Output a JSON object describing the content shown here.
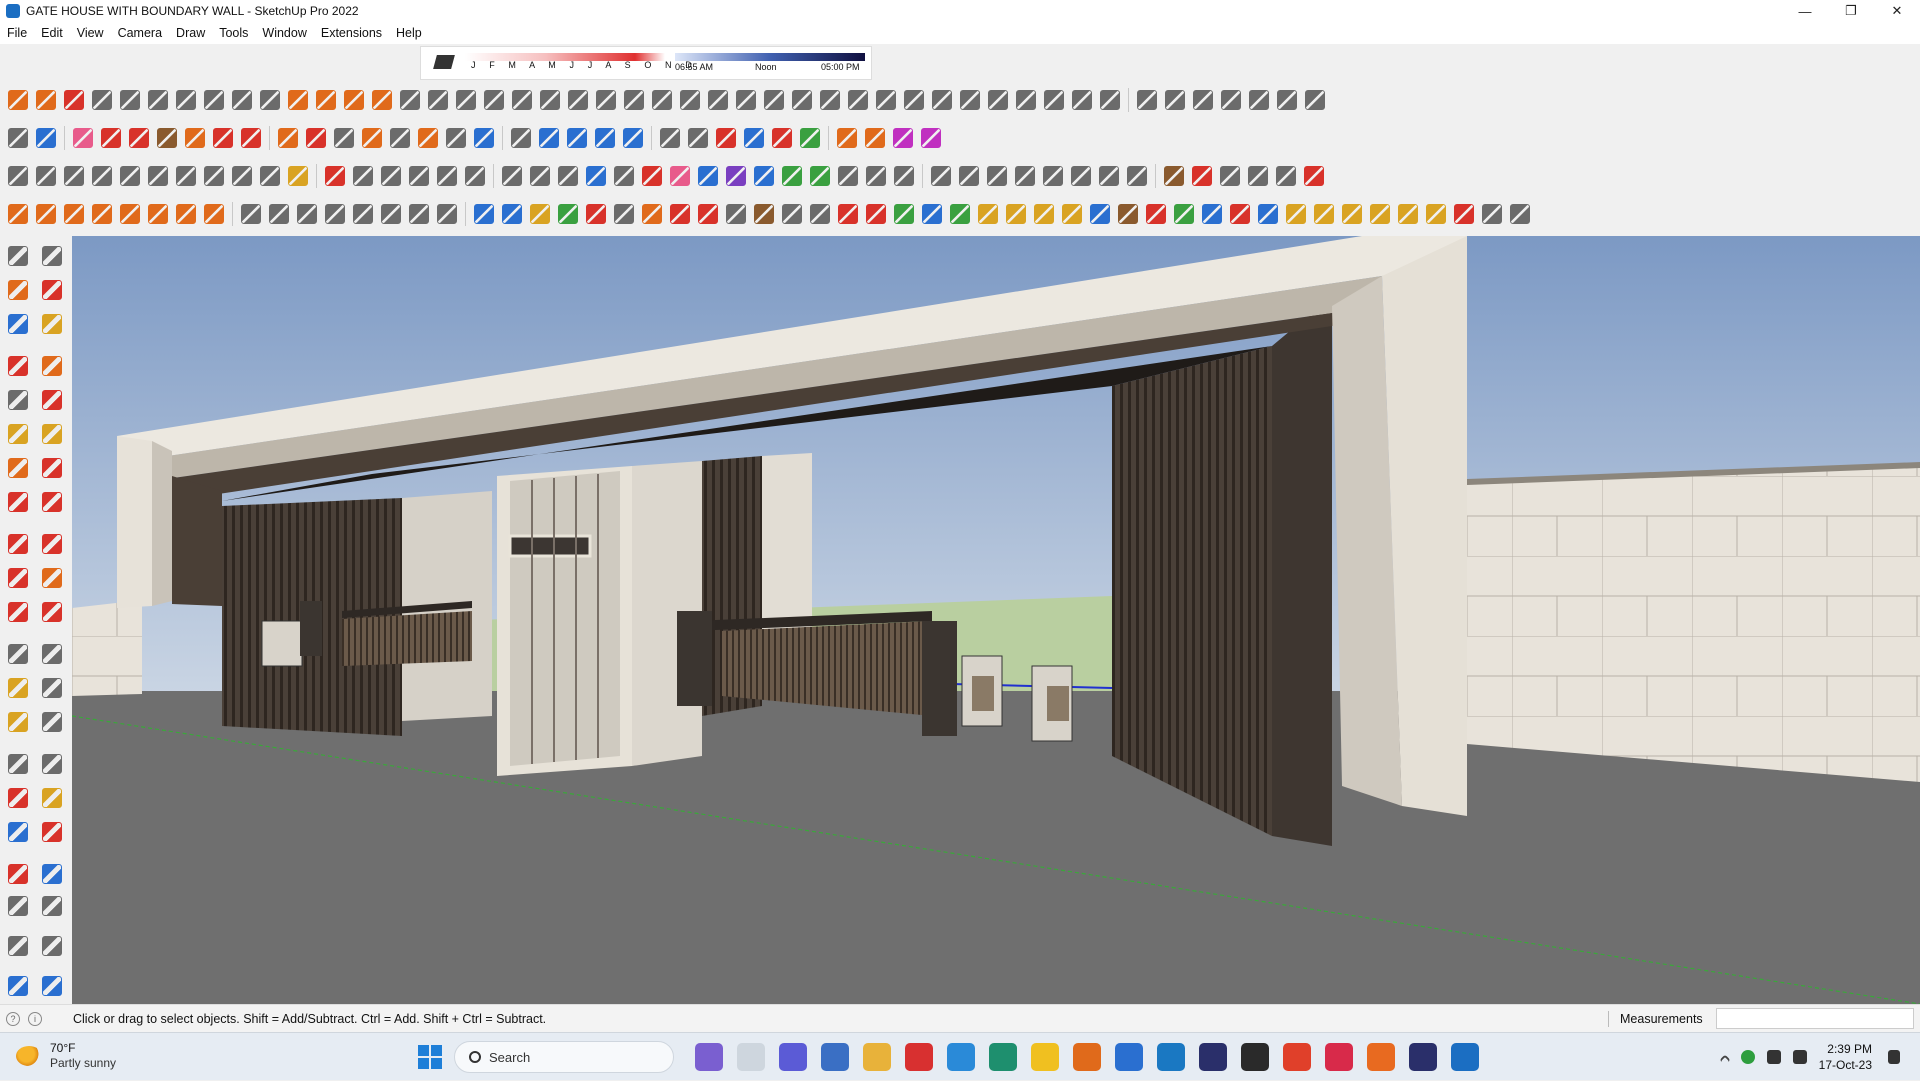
{
  "window": {
    "title": "GATE HOUSE WITH BOUNDARY WALL - SketchUp Pro 2022",
    "minimize_symbol": "—",
    "restore_symbol": "❐",
    "close_symbol": "✕"
  },
  "menu": [
    "File",
    "Edit",
    "View",
    "Camera",
    "Draw",
    "Tools",
    "Window",
    "Extensions",
    "Help"
  ],
  "shadows": {
    "months": "J F M A M J J A S O N D",
    "time_start": "06:55 AM",
    "time_noon": "Noon",
    "time_end": "05:00 PM"
  },
  "toolbar_icons": {
    "row1": [
      "orange",
      "orange",
      "red",
      "gray",
      "gray",
      "gray",
      "gray",
      "gray",
      "gray",
      "gray",
      "orange",
      "orange",
      "orange",
      "orange",
      "gray",
      "gray",
      "gray",
      "gray",
      "gray",
      "gray",
      "gray",
      "gray",
      "gray",
      "gray",
      "gray",
      "gray",
      "gray",
      "gray",
      "gray",
      "gray",
      "gray",
      "gray",
      "gray",
      "gray",
      "gray",
      "gray",
      "gray",
      "gray",
      "gray",
      "gray",
      "gray",
      "gray",
      "gray",
      "gray",
      "gray",
      "gray",
      "gray"
    ],
    "row2": [
      "gray",
      "blue",
      "pink",
      "red",
      "red",
      "brown",
      "orange",
      "red",
      "red",
      "orange",
      "red",
      "gray",
      "orange",
      "gray",
      "orange",
      "gray",
      "blue",
      "gray",
      "blue",
      "blue",
      "blue",
      "blue",
      "gray",
      "gray",
      "red",
      "blue",
      "red",
      "green",
      "orange",
      "orange",
      "magenta",
      "magenta"
    ],
    "row3": [
      "gray",
      "gray",
      "gray",
      "gray",
      "gray",
      "gray",
      "gray",
      "gray",
      "gray",
      "gray",
      "gold",
      "red",
      "gray",
      "gray",
      "gray",
      "gray",
      "gray",
      "gray",
      "gray",
      "gray",
      "blue",
      "gray",
      "red",
      "pink",
      "blue",
      "purple",
      "blue",
      "green",
      "green",
      "gray",
      "gray",
      "gray",
      "gray",
      "gray",
      "gray",
      "gray",
      "gray",
      "gray",
      "gray",
      "gray",
      "brown",
      "red",
      "gray",
      "gray",
      "gray",
      "red"
    ],
    "row4": [
      "orange",
      "orange",
      "orange",
      "orange",
      "orange",
      "orange",
      "orange",
      "orange",
      "gray",
      "gray",
      "gray",
      "gray",
      "gray",
      "gray",
      "gray",
      "gray",
      "blue",
      "blue",
      "gold",
      "green",
      "red",
      "gray",
      "orange",
      "red",
      "red",
      "gray",
      "brown",
      "gray",
      "gray",
      "red",
      "red",
      "green",
      "blue",
      "green",
      "gold",
      "gold",
      "gold",
      "gold",
      "blue",
      "brown",
      "red",
      "green",
      "blue",
      "red",
      "blue",
      "gold",
      "gold",
      "gold",
      "gold",
      "gold",
      "gold",
      "red",
      "gray",
      "gray"
    ]
  },
  "status": {
    "message": "Click or drag to select objects. Shift = Add/Subtract. Ctrl = Add. Shift + Ctrl = Subtract.",
    "measurements_label": "Measurements",
    "measurements_value": ""
  },
  "taskbar": {
    "temperature": "70°F",
    "condition": "Partly sunny",
    "search_placeholder": "Search",
    "time": "2:39 PM",
    "date": "17-Oct-23"
  },
  "colors": {
    "accent": "#1b6ec2",
    "sky_top": "#7c99c4",
    "sky_bottom": "#d2dbe6",
    "ground": "#6f6f6f"
  }
}
